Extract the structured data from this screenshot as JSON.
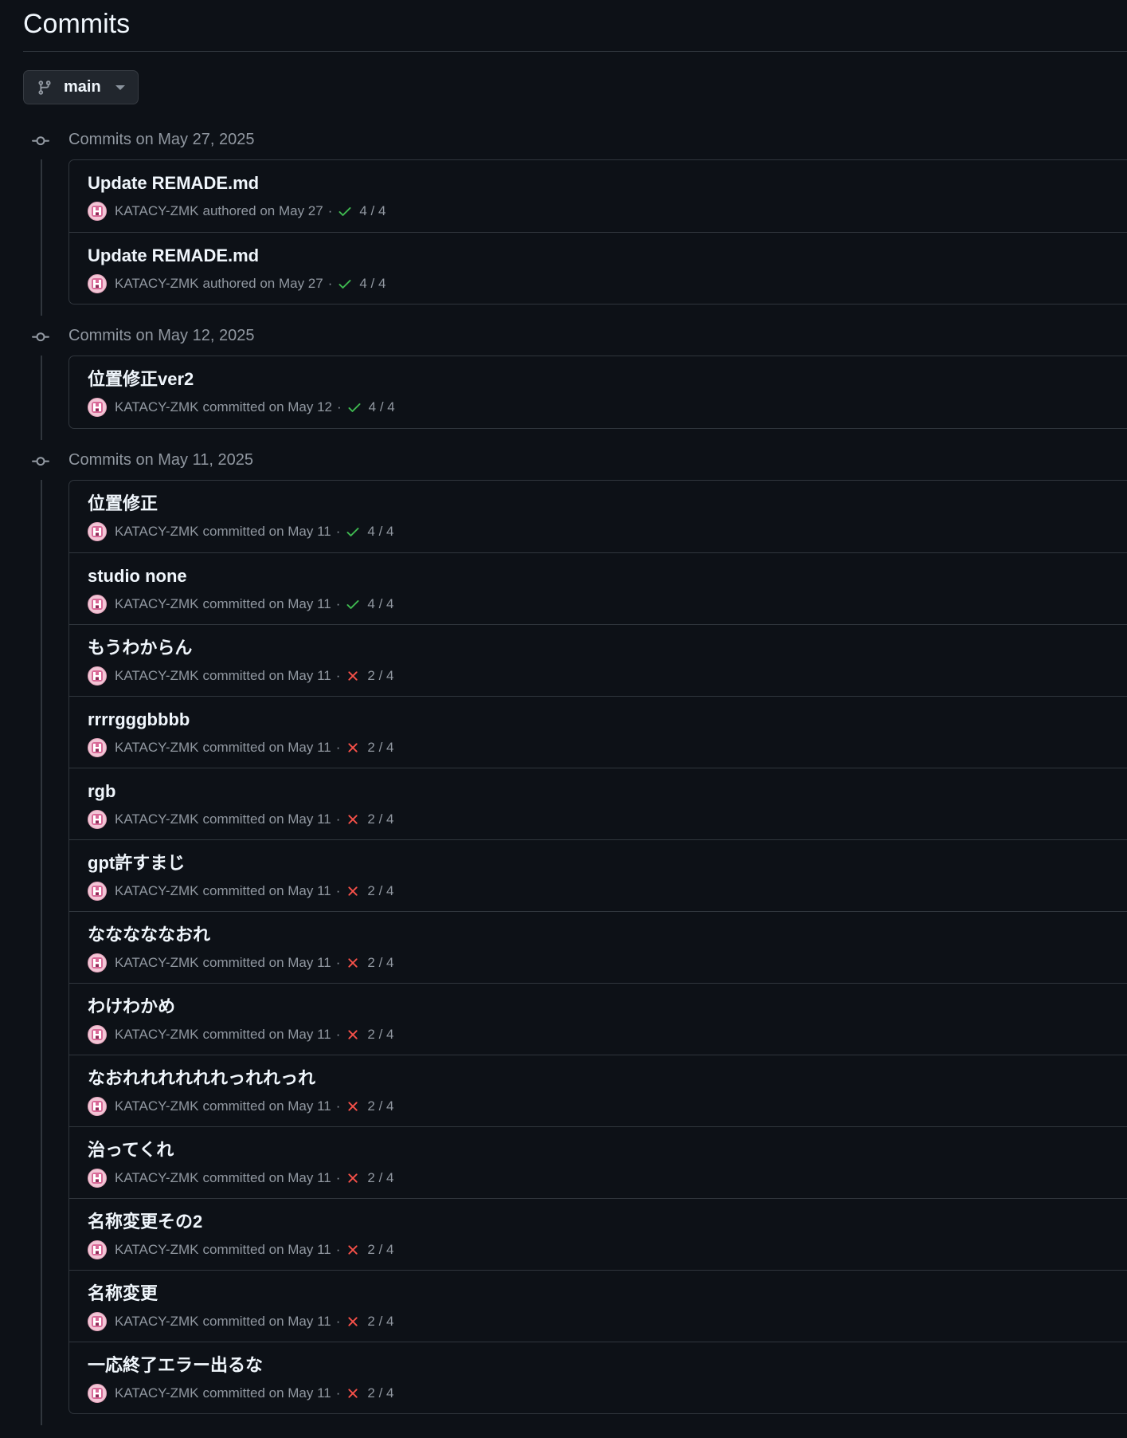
{
  "page": {
    "title": "Commits"
  },
  "branch": {
    "label": "main"
  },
  "colors": {
    "success": "#3fb950",
    "failure": "#f85149"
  },
  "groups": [
    {
      "label": "Commits on May 27, 2025",
      "commits": [
        {
          "title": "Update REMADE.md",
          "author": "KATACY-ZMK",
          "verb": "authored on May 27",
          "status": "success",
          "checks": "4 / 4"
        },
        {
          "title": "Update REMADE.md",
          "author": "KATACY-ZMK",
          "verb": "authored on May 27",
          "status": "success",
          "checks": "4 / 4"
        }
      ]
    },
    {
      "label": "Commits on May 12, 2025",
      "commits": [
        {
          "title": "位置修正ver2",
          "author": "KATACY-ZMK",
          "verb": "committed on May 12",
          "status": "success",
          "checks": "4 / 4"
        }
      ]
    },
    {
      "label": "Commits on May 11, 2025",
      "commits": [
        {
          "title": "位置修正",
          "author": "KATACY-ZMK",
          "verb": "committed on May 11",
          "status": "success",
          "checks": "4 / 4"
        },
        {
          "title": "studio none",
          "author": "KATACY-ZMK",
          "verb": "committed on May 11",
          "status": "success",
          "checks": "4 / 4"
        },
        {
          "title": "もうわからん",
          "author": "KATACY-ZMK",
          "verb": "committed on May 11",
          "status": "failure",
          "checks": "2 / 4"
        },
        {
          "title": "rrrrgggbbbb",
          "author": "KATACY-ZMK",
          "verb": "committed on May 11",
          "status": "failure",
          "checks": "2 / 4"
        },
        {
          "title": "rgb",
          "author": "KATACY-ZMK",
          "verb": "committed on May 11",
          "status": "failure",
          "checks": "2 / 4"
        },
        {
          "title": "gpt許すまじ",
          "author": "KATACY-ZMK",
          "verb": "committed on May 11",
          "status": "failure",
          "checks": "2 / 4"
        },
        {
          "title": "なななななおれ",
          "author": "KATACY-ZMK",
          "verb": "committed on May 11",
          "status": "failure",
          "checks": "2 / 4"
        },
        {
          "title": "わけわかめ",
          "author": "KATACY-ZMK",
          "verb": "committed on May 11",
          "status": "failure",
          "checks": "2 / 4"
        },
        {
          "title": "なおれれれれれれっれれっれ",
          "author": "KATACY-ZMK",
          "verb": "committed on May 11",
          "status": "failure",
          "checks": "2 / 4"
        },
        {
          "title": "治ってくれ",
          "author": "KATACY-ZMK",
          "verb": "committed on May 11",
          "status": "failure",
          "checks": "2 / 4"
        },
        {
          "title": "名称変更その2",
          "author": "KATACY-ZMK",
          "verb": "committed on May 11",
          "status": "failure",
          "checks": "2 / 4"
        },
        {
          "title": "名称変更",
          "author": "KATACY-ZMK",
          "verb": "committed on May 11",
          "status": "failure",
          "checks": "2 / 4"
        },
        {
          "title": "一応終了エラー出るな",
          "author": "KATACY-ZMK",
          "verb": "committed on May 11",
          "status": "failure",
          "checks": "2 / 4"
        }
      ]
    }
  ]
}
